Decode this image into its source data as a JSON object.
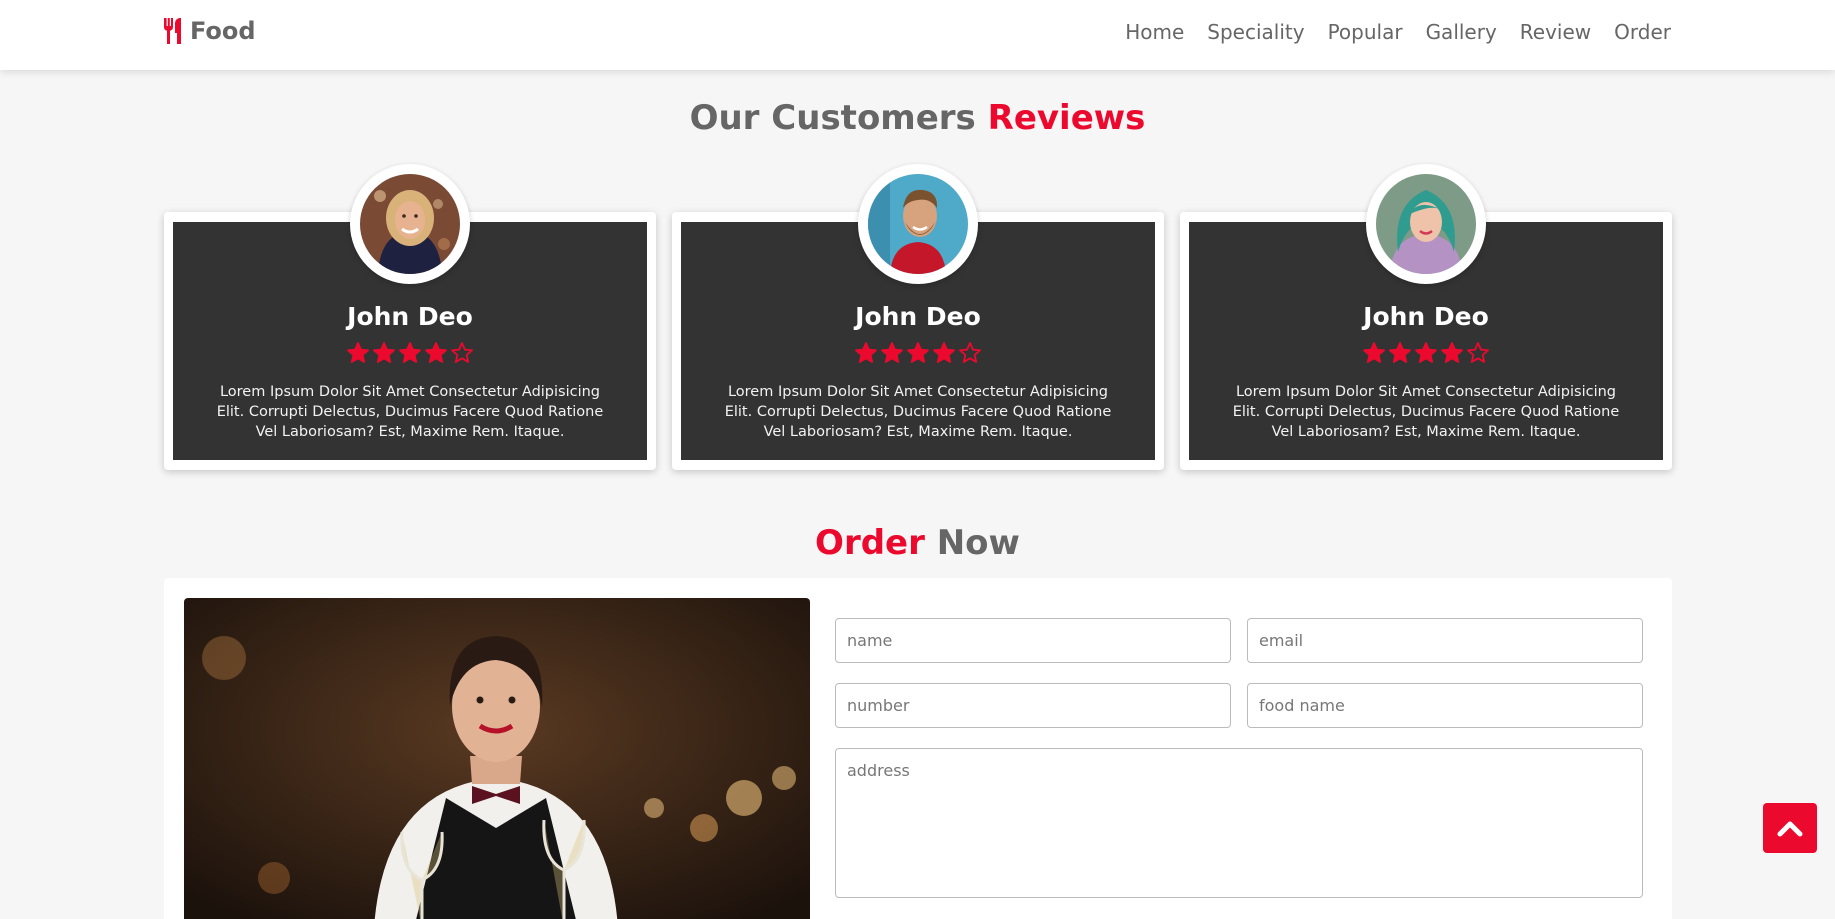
{
  "header": {
    "logo_text": "Food",
    "logo_icon": "utensils-icon",
    "nav": [
      "Home",
      "Speciality",
      "Popular",
      "Gallery",
      "Review",
      "Order"
    ]
  },
  "reviews": {
    "heading_plain": "Our Customers ",
    "heading_accent": "Reviews",
    "cards": [
      {
        "name": "John Deo",
        "rating": 4,
        "max_rating": 5,
        "text": "Lorem Ipsum Dolor Sit Amet Consectetur Adipisicing Elit. Corrupti Delectus, Ducimus Facere Quod Ratione Vel Laboriosam? Est, Maxime Rem. Itaque."
      },
      {
        "name": "John Deo",
        "rating": 4,
        "max_rating": 5,
        "text": "Lorem Ipsum Dolor Sit Amet Consectetur Adipisicing Elit. Corrupti Delectus, Ducimus Facere Quod Ratione Vel Laboriosam? Est, Maxime Rem. Itaque."
      },
      {
        "name": "John Deo",
        "rating": 4,
        "max_rating": 5,
        "text": "Lorem Ipsum Dolor Sit Amet Consectetur Adipisicing Elit. Corrupti Delectus, Ducimus Facere Quod Ratione Vel Laboriosam? Est, Maxime Rem. Itaque."
      }
    ]
  },
  "order": {
    "heading_accent": "Order",
    "heading_plain": " Now",
    "placeholders": {
      "name": "name",
      "email": "email",
      "number": "number",
      "food_name": "food name",
      "address": "address"
    }
  },
  "colors": {
    "accent": "#eb0a2e",
    "card_bg": "#333333",
    "page_bg": "#f6f6f6"
  },
  "icons": {
    "scroll_top": "chevron-up-icon",
    "star_full": "star-filled-icon",
    "star_empty": "star-outline-icon"
  }
}
